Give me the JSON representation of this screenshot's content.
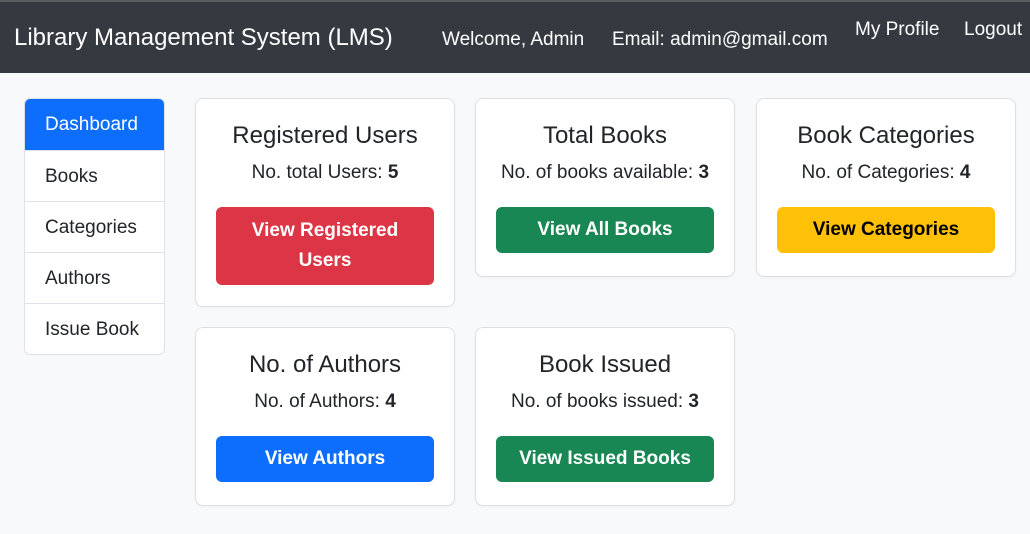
{
  "navbar": {
    "brand": "Library Management System (LMS)",
    "welcome": "Welcome, Admin",
    "email": "Email: admin@gmail.com",
    "profile": "My Profile",
    "logout": "Logout"
  },
  "sidebar": {
    "items": [
      {
        "label": "Dashboard",
        "active": true
      },
      {
        "label": "Books",
        "active": false
      },
      {
        "label": "Categories",
        "active": false
      },
      {
        "label": "Authors",
        "active": false
      },
      {
        "label": "Issue Book",
        "active": false
      }
    ]
  },
  "cards": {
    "users": {
      "title": "Registered Users",
      "label": "No. total Users: ",
      "value": "5",
      "button": "View Registered Users"
    },
    "books": {
      "title": "Total Books",
      "label": "No. of books available: ",
      "value": "3",
      "button": "View All Books"
    },
    "categories": {
      "title": "Book Categories",
      "label": "No. of Categories: ",
      "value": "4",
      "button": "View Categories"
    },
    "authors": {
      "title": "No. of Authors",
      "label": "No. of Authors: ",
      "value": "4",
      "button": "View Authors"
    },
    "issued": {
      "title": "Book Issued",
      "label": "No. of books issued: ",
      "value": "3",
      "button": "View Issued Books"
    }
  },
  "colors": {
    "navbar": "#343a40",
    "primary": "#0d6efd",
    "danger": "#dc3545",
    "success": "#198754",
    "warning": "#ffc107"
  }
}
